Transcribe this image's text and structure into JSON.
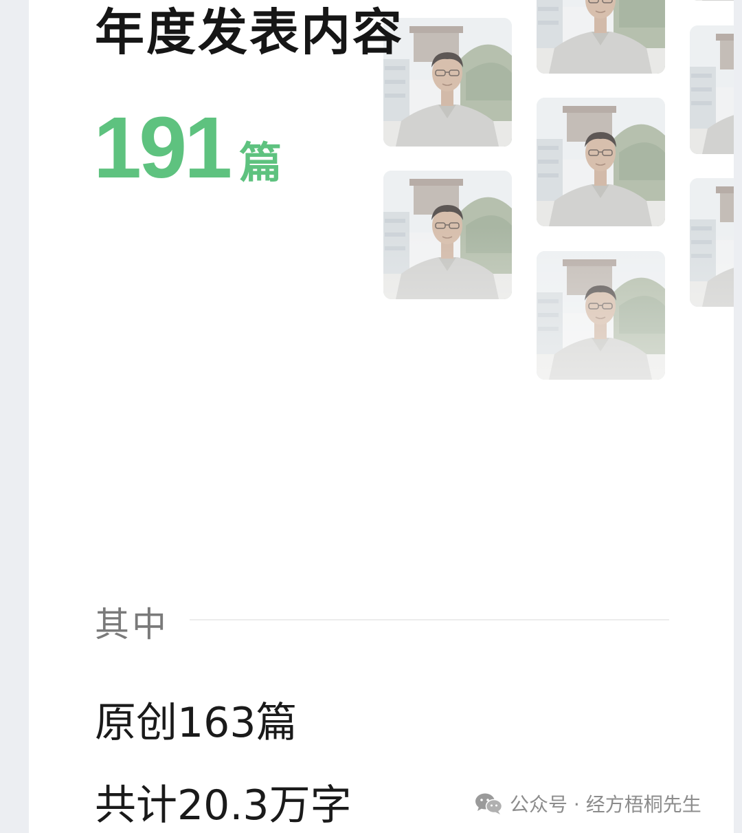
{
  "report": {
    "title": "年度发表内容",
    "count": "191",
    "unit": "篇"
  },
  "breakdown": {
    "label": "其中",
    "original": "原创163篇",
    "total_words": "共计20.3万字"
  },
  "watermark": {
    "icon": "wechat-icon",
    "text": "公众号 · 经方梧桐先生"
  },
  "colors": {
    "accent_green": "#5ec27f",
    "title_text": "#161616",
    "muted_text": "#7a7a7a",
    "page_background": "#eceef2"
  }
}
